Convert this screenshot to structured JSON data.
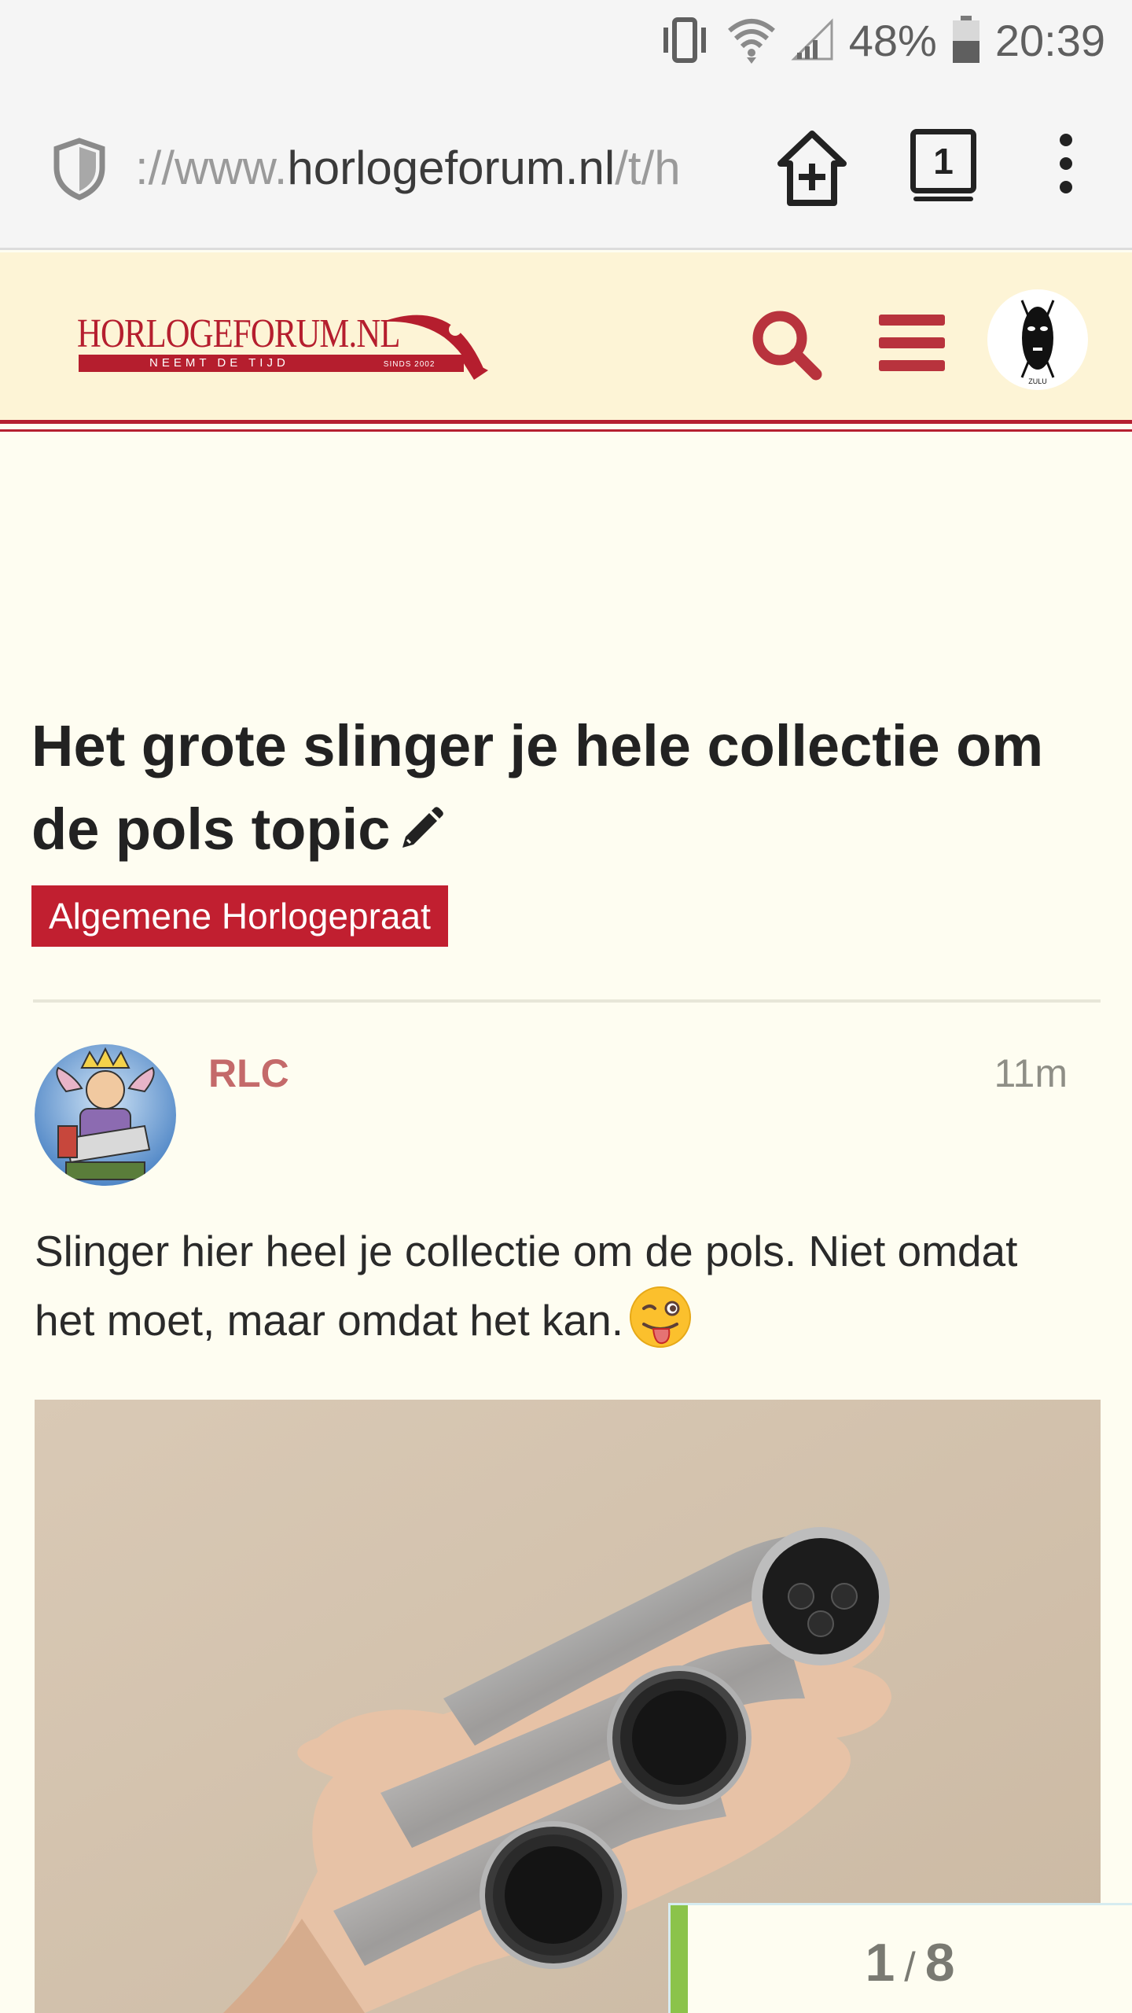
{
  "status_bar": {
    "battery": "48%",
    "time": "20:39"
  },
  "browser": {
    "url_prefix": "://www.",
    "url_domain": "horlogeforum.nl",
    "url_path": "/t/h",
    "tab_count": "1"
  },
  "site": {
    "logo_title": "HORLOGEFORUM.NL",
    "logo_tagline": "NEEMT DE TIJD",
    "logo_since": "SINDS 2002",
    "avatar_label": "ZULU",
    "accent_color": "#b51e2e"
  },
  "topic": {
    "title": "Het grote slinger je hele collectie om de pols topic",
    "category": "Algemene Horlogepraat"
  },
  "post": {
    "username": "RLC",
    "time": "11m",
    "body": "Slinger hier heel je collectie om de pols. Niet omdat het moet, maar omdat het kan."
  },
  "progress": {
    "current": "1",
    "separator": "/",
    "total": "8"
  }
}
